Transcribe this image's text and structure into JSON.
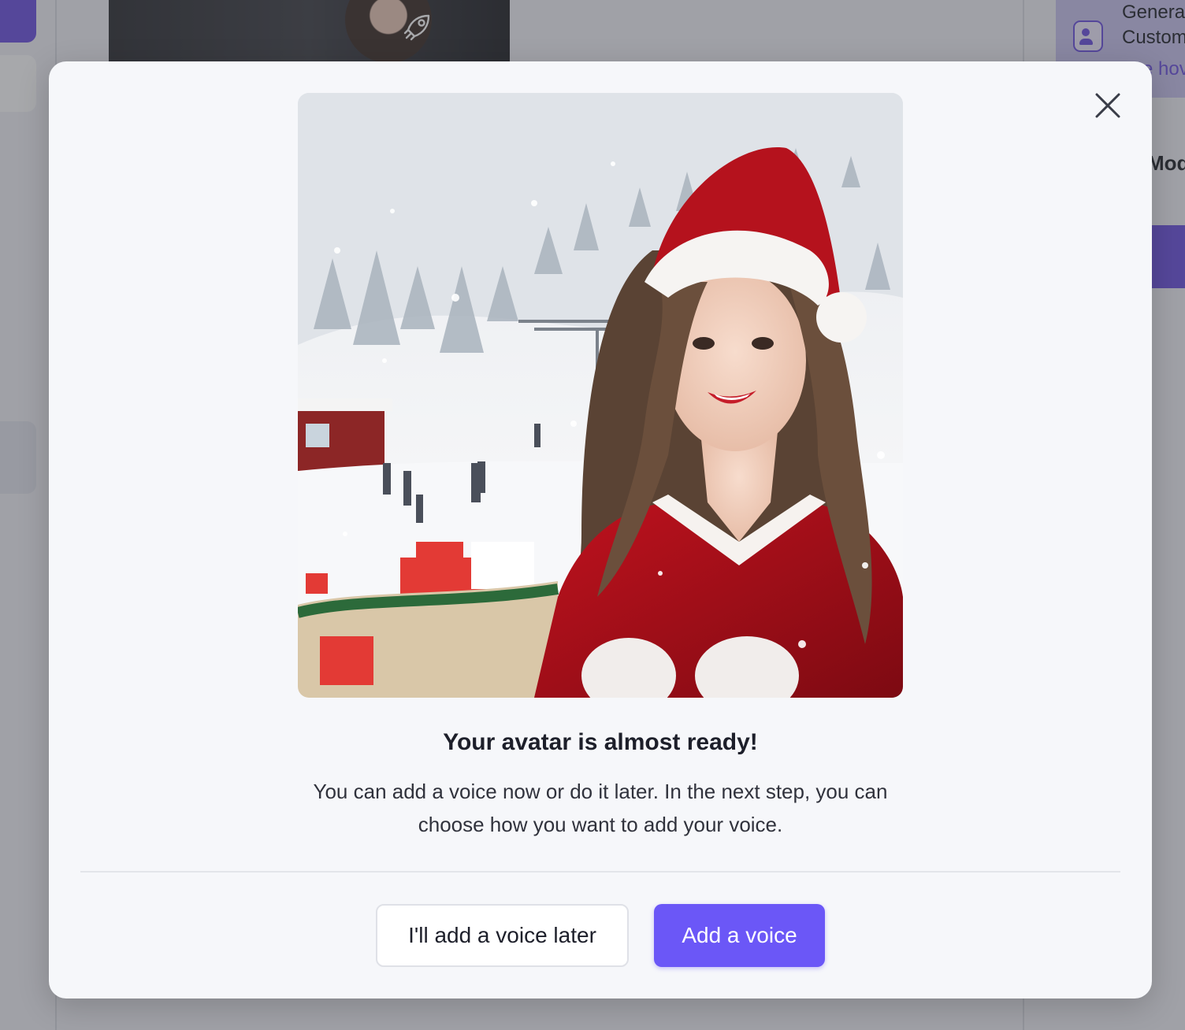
{
  "background": {
    "right_panel": {
      "line1": "Genera",
      "line2": "Custom",
      "link": "e hov",
      "heading": "Mod"
    }
  },
  "modal": {
    "image_alt": "Avatar preview: woman in Santa outfit at a snowy ski resort",
    "title": "Your avatar is almost ready!",
    "description": "You can add a voice now or do it later. In the next step, you can choose how you want to add your voice.",
    "buttons": {
      "later": "I'll add a voice later",
      "add": "Add a voice"
    }
  },
  "colors": {
    "accent": "#6b57f7",
    "modal_bg": "#f6f7fa",
    "title": "#1d1f2a"
  },
  "icons": {
    "close": "close-icon",
    "rocket": "rocket-icon",
    "user_voice": "user-voice-icon"
  }
}
